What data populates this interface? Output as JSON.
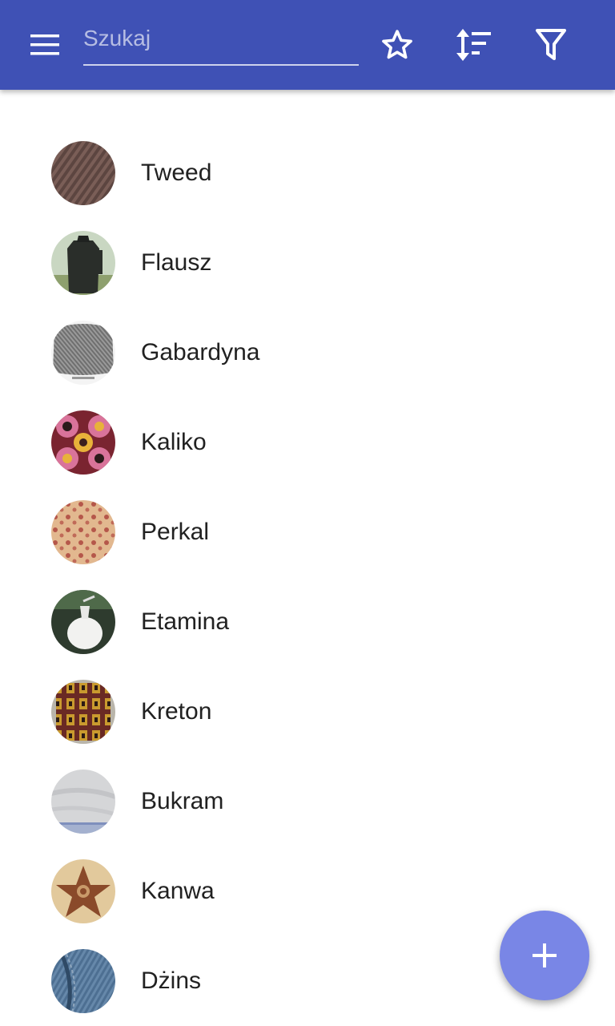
{
  "toolbar": {
    "search_placeholder": "Szukaj",
    "menu_icon": "menu-icon",
    "favorites_icon": "star-outline-icon",
    "sort_icon": "sort-icon",
    "filter_icon": "filter-icon"
  },
  "fabrics": [
    {
      "label": "Tweed"
    },
    {
      "label": "Flausz"
    },
    {
      "label": "Gabardyna"
    },
    {
      "label": "Kaliko"
    },
    {
      "label": "Perkal"
    },
    {
      "label": "Etamina"
    },
    {
      "label": "Kreton"
    },
    {
      "label": "Bukram"
    },
    {
      "label": "Kanwa"
    },
    {
      "label": "Dżins"
    }
  ],
  "fab": {
    "icon": "plus-icon"
  },
  "colors": {
    "primary": "#3f51b5",
    "accent": "#7986e6",
    "text": "#212121"
  }
}
